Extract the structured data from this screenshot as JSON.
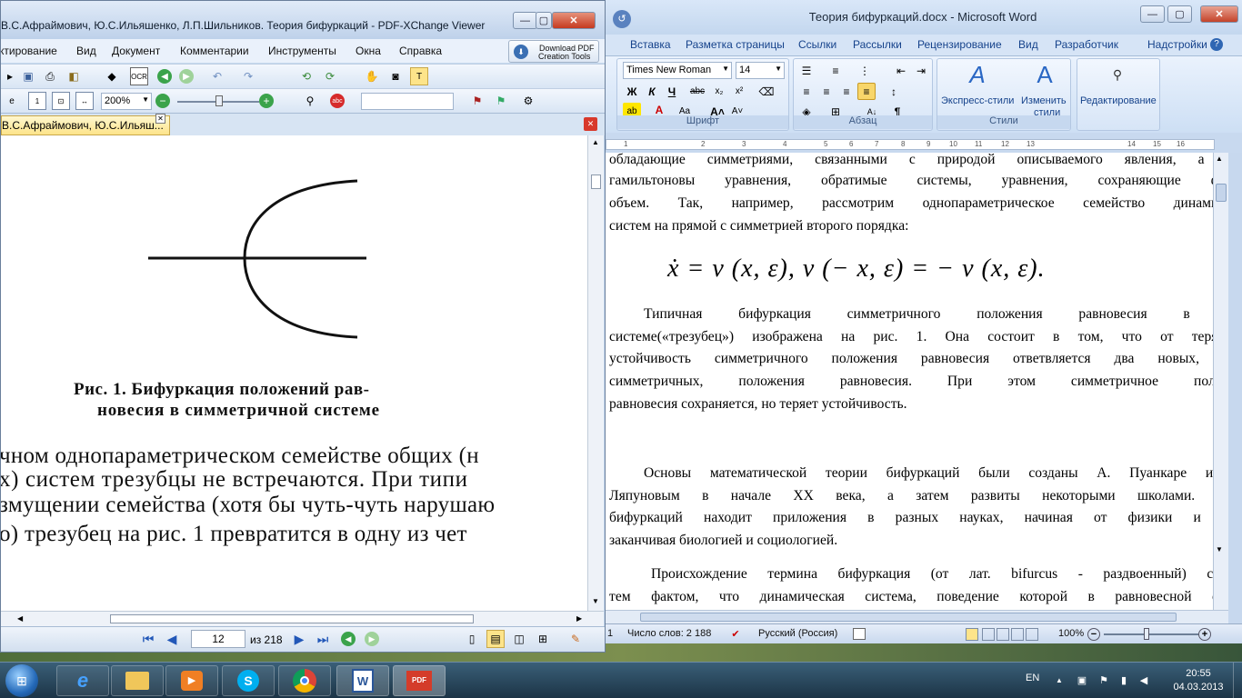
{
  "word": {
    "title": "Теория бифуркаций.docx - Microsoft Word",
    "tabs": [
      "Вставка",
      "Разметка страницы",
      "Ссылки",
      "Рассылки",
      "Рецензирование",
      "Вид",
      "Разработчик",
      "Надстройки"
    ],
    "font_name": "Times New Roman",
    "font_size": "14",
    "groups": {
      "font": "Шрифт",
      "paragraph": "Абзац",
      "styles": "Стили"
    },
    "express_styles": "Экспресс-стили",
    "change_styles_1": "Изменить",
    "change_styles_2": "стили",
    "editing": "Редактирование",
    "ruler_numbers": [
      "1",
      "2",
      "3",
      "4",
      "5",
      "6",
      "7",
      "8",
      "9",
      "10",
      "11",
      "12",
      "13",
      "14",
      "15",
      "16"
    ],
    "paragraphs": [
      "обладающие симметриями, связанными с природой описываемого явления, а так",
      "гамильтоновы уравнения, обратимые системы, уравнения, сохраняющие фазов",
      "объем. Так, например, рассмотрим однопараметрическое семейство динамическ",
      "систем на прямой с симметрией второго порядка:",
      "Типичная бифуркация симметричного положения равновесия в так",
      "системе(«трезубец») изображена на рис. 1. Она состоит в том, что от теряюще",
      "устойчивость симметричного положения равновесия ответвляется два новых, мен",
      "симметричных, положения равновесия. При этом симметричное положен",
      "равновесия сохраняется, но теряет устойчивость.",
      "Основы математической теории бифуркаций были созданы А. Пуанкаре и А.",
      "Ляпуновым в начале XX века, а затем развиты некоторыми школами. Теор",
      "бифуркаций находит приложения в разных науках, начиная от физики и хим",
      "заканчивая биологией и социологией.",
      "Происхождение термина бифуркация (от лат. bifurcus - раздвоенный) связан",
      "тем фактом, что динамическая  система, поведение которой в равновесной облас"
    ],
    "formula": "ẋ = v (x, ε),   v (− x, ε) = − v (x, ε).",
    "status": {
      "page_fragment": "1",
      "words": "Число слов: 2 188",
      "language": "Русский (Россия)",
      "zoom": "100%"
    }
  },
  "pdf": {
    "title": "В.С.Афраймович, Ю.С.Ильяшенко, Л.П.Шильников. Теория бифуркаций - PDF-XChange Viewer",
    "menu": [
      "ктирование",
      "Вид",
      "Документ",
      "Комментарии",
      "Инструменты",
      "Окна",
      "Справка"
    ],
    "download_1": "Download PDF",
    "download_2": "Creation Tools",
    "zoom": "200%",
    "tab_label": "В.С.Афраймович, Ю.С.Ильяш...",
    "caption_1": "Рис. 1. Бифуркация положений рав-",
    "caption_2": "новесия в симметричной системе",
    "scan_lines": [
      "чном однопараметрическом семействе общих (н",
      "х) систем трезубцы не  встречаются. При  типи",
      "змущении семейства (хотя бы чуть-чуть нарушаю",
      "о) трезубец на рис. 1 превратится в одну из чет"
    ],
    "page_current": "12",
    "page_total": "из 218"
  },
  "taskbar": {
    "lang": "EN",
    "time": "20:55",
    "date": "04.03.2013"
  },
  "colors": {
    "word_chrome": "#c7d8ee",
    "pdf_tab": "#fde48a",
    "taskbar": "#1c3446"
  }
}
